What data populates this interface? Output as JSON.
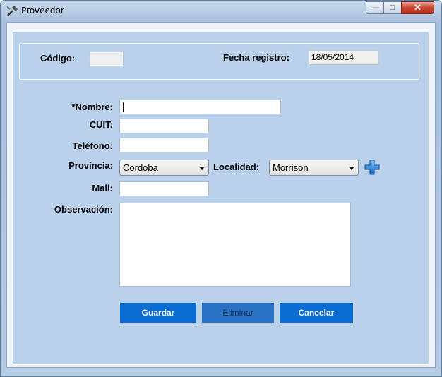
{
  "window": {
    "title": "Proveedor",
    "icon": "tools-icon",
    "minimize": "0",
    "maximize": "1",
    "close": "r"
  },
  "header": {
    "codigo_label": "Código:",
    "codigo_value": "",
    "fecha_label": "Fecha registro:",
    "fecha_value": "18/05/2014"
  },
  "form": {
    "nombre_label": "*Nombre:",
    "nombre_value": "",
    "cuit_label": "CUIT:",
    "cuit_value": "",
    "telefono_label": "Teléfono:",
    "telefono_value": "",
    "provincia_label": "Província:",
    "provincia_value": "Cordoba",
    "localidad_label": "Localidad:",
    "localidad_value": "Morrison",
    "add_localidad_icon": "plus-icon",
    "mail_label": "Mail:",
    "mail_value": "",
    "observacion_label": "Observación:",
    "observacion_value": ""
  },
  "buttons": {
    "guardar": "Guardar",
    "eliminar": "Eliminar",
    "cancelar": "Cancelar"
  },
  "colors": {
    "panel": "#b9d1ea",
    "button": "#0b6dd1",
    "button_text": "#ffffff"
  }
}
